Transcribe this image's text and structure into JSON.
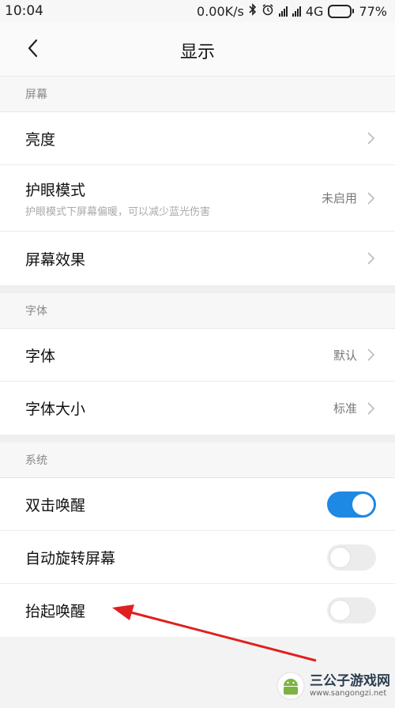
{
  "status_bar": {
    "time": "10:04",
    "speed": "0.00K/s",
    "network": "4G",
    "battery": "77%",
    "battery_level": 0.77
  },
  "header": {
    "title": "显示"
  },
  "sections": [
    {
      "header": "屏幕",
      "rows": [
        {
          "label": "亮度",
          "desc": "",
          "value": ""
        },
        {
          "label": "护眼模式",
          "desc": "护眼模式下屏幕偏暖，可以减少蓝光伤害",
          "value": "未启用"
        },
        {
          "label": "屏幕效果",
          "desc": "",
          "value": ""
        }
      ]
    },
    {
      "header": "字体",
      "rows": [
        {
          "label": "字体",
          "value": "默认"
        },
        {
          "label": "字体大小",
          "value": "标准"
        }
      ]
    },
    {
      "header": "系统",
      "rows": [
        {
          "label": "双击唤醒",
          "toggle": true
        },
        {
          "label": "自动旋转屏幕",
          "toggle": false
        },
        {
          "label": "抬起唤醒",
          "toggle": false
        }
      ]
    }
  ],
  "annotation": {
    "color": "#e02020"
  },
  "watermark": {
    "title": "三公子游戏网",
    "url": "www.sangongzi.net"
  }
}
